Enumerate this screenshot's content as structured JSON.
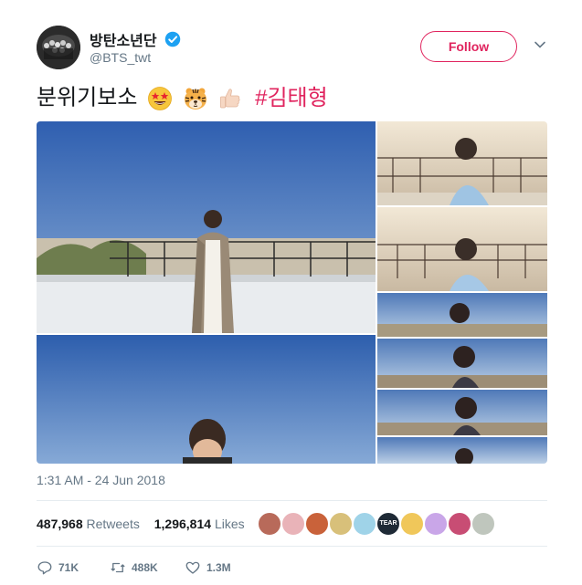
{
  "user": {
    "display_name": "방탄소년단",
    "handle": "@BTS_twt",
    "verified": true
  },
  "follow_button": {
    "label": "Follow"
  },
  "tweet": {
    "text": "분위기보소",
    "emojis": [
      "star-struck-emoji",
      "tiger-face-emoji",
      "thumbs-up-emoji"
    ],
    "hashtag": "#김태형"
  },
  "timestamp": "1:31 AM - 24 Jun 2018",
  "stats": {
    "retweets_count": "487,968",
    "retweets_label": "Retweets",
    "likes_count": "1,296,814",
    "likes_label": "Likes"
  },
  "likers": {
    "colors": [
      "#b86a5a",
      "#e9b3b8",
      "#c9623a",
      "#d8c07a",
      "#9fd3e8",
      "#1f2a36",
      "#f0c75a",
      "#c9a6e8",
      "#c84d74",
      "#bfc6bd"
    ],
    "badge_text": "TEAR"
  },
  "actions": {
    "reply_count": "71K",
    "retweet_count": "488K",
    "like_count": "1.3M"
  },
  "colors": {
    "accent": "#e0245e",
    "verified": "#1da1f2",
    "muted": "#657786",
    "sky": "#3f6fb3"
  }
}
